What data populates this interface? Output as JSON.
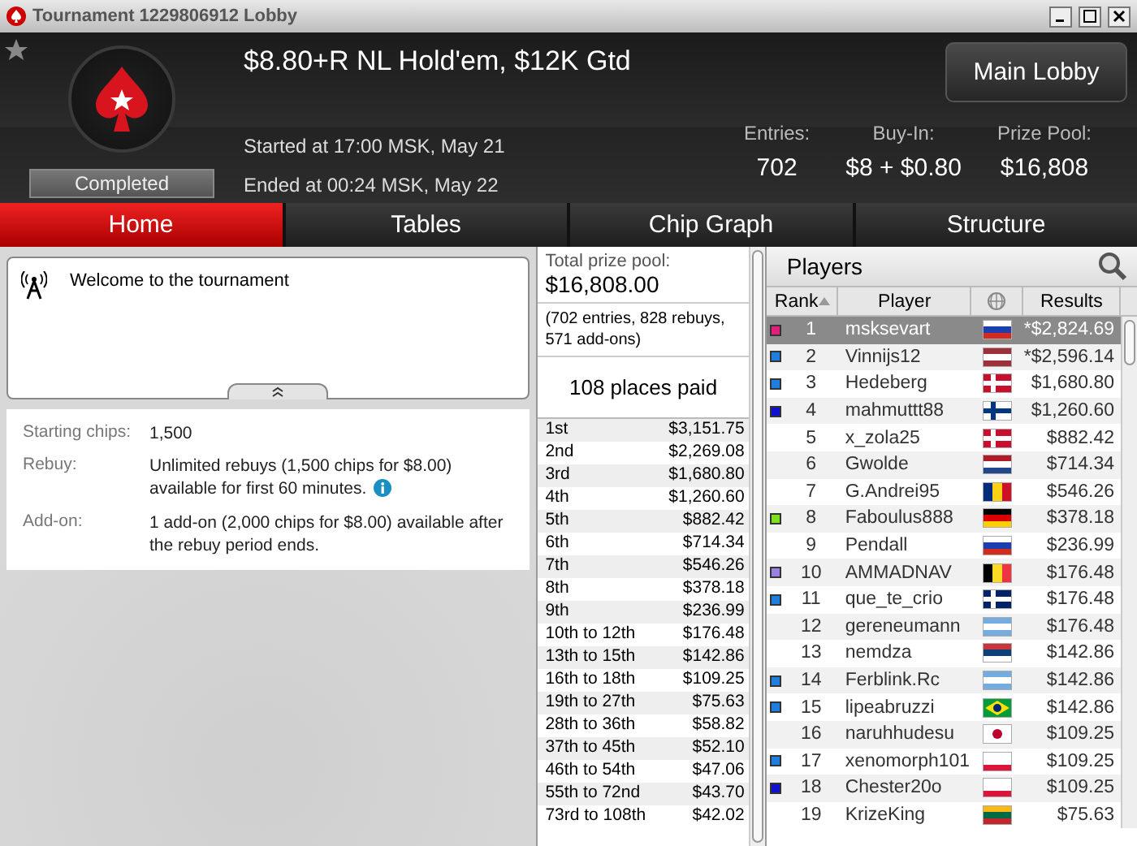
{
  "window": {
    "title": "Tournament 1229806912 Lobby"
  },
  "header": {
    "name": "$8.80+R NL Hold'em, $12K Gtd",
    "status": "Completed",
    "started": "Started at 17:00 MSK, May 21",
    "ended": "Ended at 00:24 MSK, May 22",
    "main_lobby": "Main Lobby",
    "stats": [
      {
        "label": "Entries:",
        "value": "702"
      },
      {
        "label": "Buy-In:",
        "value": "$8 + $0.80"
      },
      {
        "label": "Prize Pool:",
        "value": "$16,808"
      }
    ]
  },
  "tabs": [
    {
      "label": "Home",
      "selected": true
    },
    {
      "label": "Tables",
      "selected": false
    },
    {
      "label": "Chip Graph",
      "selected": false
    },
    {
      "label": "Structure",
      "selected": false
    }
  ],
  "news": {
    "text": "Welcome to the tournament"
  },
  "info": [
    {
      "label": "Starting chips:",
      "value": "1,500",
      "info": false
    },
    {
      "label": "Rebuy:",
      "value": "Unlimited rebuys (1,500 chips for $8.00) available for first 60 minutes.",
      "info": true
    },
    {
      "label": "Add-on:",
      "value": "1 add-on (2,000 chips for $8.00) available after the rebuy period ends.",
      "info": false
    }
  ],
  "prizes": {
    "total_label": "Total prize pool:",
    "total": "$16,808.00",
    "note": "(702 entries, 828 rebuys, 571 add-ons)",
    "places": "108 places paid",
    "rows": [
      [
        "1st",
        "$3,151.75"
      ],
      [
        "2nd",
        "$2,269.08"
      ],
      [
        "3rd",
        "$1,680.80"
      ],
      [
        "4th",
        "$1,260.60"
      ],
      [
        "5th",
        "$882.42"
      ],
      [
        "6th",
        "$714.34"
      ],
      [
        "7th",
        "$546.26"
      ],
      [
        "8th",
        "$378.18"
      ],
      [
        "9th",
        "$236.99"
      ],
      [
        "10th to 12th",
        "$176.48"
      ],
      [
        "13th to 15th",
        "$142.86"
      ],
      [
        "16th to 18th",
        "$109.25"
      ],
      [
        "19th to 27th",
        "$75.63"
      ],
      [
        "28th to 36th",
        "$58.82"
      ],
      [
        "37th to 45th",
        "$52.10"
      ],
      [
        "46th to 54th",
        "$47.06"
      ],
      [
        "55th to 72nd",
        "$43.70"
      ],
      [
        "73rd to 108th",
        "$42.02"
      ]
    ]
  },
  "players": {
    "title": "Players",
    "columns": [
      "Rank",
      "Player",
      "Results"
    ],
    "rows": [
      {
        "rank": "1",
        "name": "msksevart",
        "result": "*$2,824.69",
        "color": "#e0207a",
        "selected": true
      },
      {
        "rank": "2",
        "name": "Vinnijs12",
        "result": "*$2,596.14",
        "color": "#1e7fe0",
        "selected": false
      },
      {
        "rank": "3",
        "name": "Hedeberg",
        "result": "$1,680.80",
        "color": "#1e7fe0",
        "selected": false
      },
      {
        "rank": "4",
        "name": "mahmuttt88",
        "result": "$1,260.60",
        "color": "#1010d0",
        "selected": false
      },
      {
        "rank": "5",
        "name": "x_zola25",
        "result": "$882.42",
        "selected": false
      },
      {
        "rank": "6",
        "name": "Gwolde",
        "result": "$714.34",
        "selected": false
      },
      {
        "rank": "7",
        "name": "G.Andrei95",
        "result": "$546.26",
        "selected": false
      },
      {
        "rank": "8",
        "name": "Faboulus888",
        "result": "$378.18",
        "color": "#7ee020",
        "selected": false
      },
      {
        "rank": "9",
        "name": "Pendall",
        "result": "$236.99",
        "selected": false
      },
      {
        "rank": "10",
        "name": "AMMADNAV",
        "result": "$176.48",
        "color": "#9a80e0",
        "selected": false
      },
      {
        "rank": "11",
        "name": "que_te_crio",
        "result": "$176.48",
        "color": "#1e7fe0",
        "selected": false
      },
      {
        "rank": "12",
        "name": "gereneumann",
        "result": "$176.48",
        "selected": false
      },
      {
        "rank": "13",
        "name": "nemdza",
        "result": "$142.86",
        "selected": false
      },
      {
        "rank": "14",
        "name": "Ferblink.Rc",
        "result": "$142.86",
        "color": "#1e7fe0",
        "selected": false
      },
      {
        "rank": "15",
        "name": "lipeabruzzi",
        "result": "$142.86",
        "color": "#1e7fe0",
        "selected": false
      },
      {
        "rank": "16",
        "name": "naruhhudesu",
        "result": "$109.25",
        "selected": false
      },
      {
        "rank": "17",
        "name": "xenomorph101",
        "result": "$109.25",
        "color": "#1e7fe0",
        "selected": false
      },
      {
        "rank": "18",
        "name": "Chester20o",
        "result": "$109.25",
        "color": "#1010d0",
        "selected": false
      },
      {
        "rank": "19",
        "name": "KrizeKing",
        "result": "$75.63",
        "selected": false
      }
    ]
  }
}
